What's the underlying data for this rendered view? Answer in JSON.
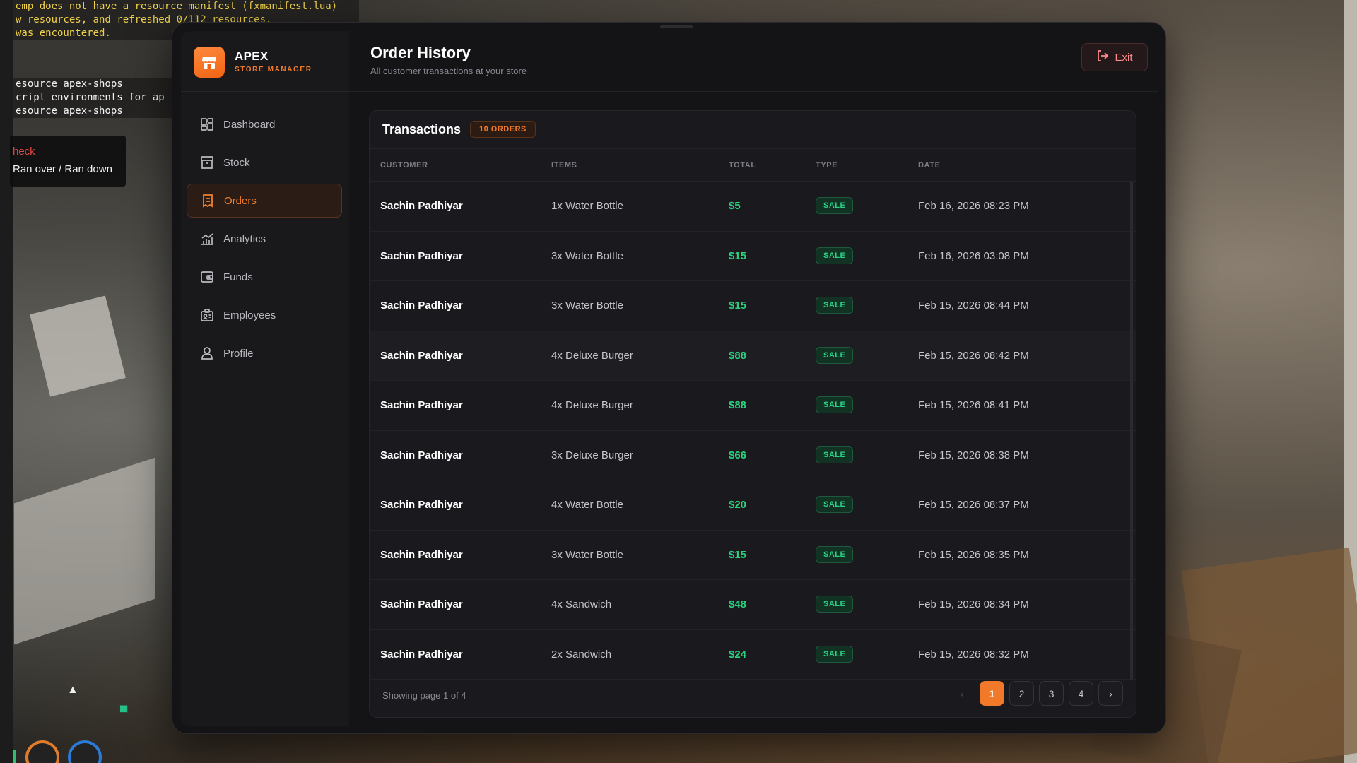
{
  "console": {
    "lines": [
      "emp does not have a resource manifest (fxmanifest.lua)",
      "w resources, and refreshed 0/112 resources.",
      " was encountered."
    ],
    "lines2": [
      "esource apex-shops",
      "cript environments for ap",
      "esource apex-shops"
    ]
  },
  "notice": {
    "title": "heck",
    "text": "Ran over / Ran down"
  },
  "brand": {
    "name": "APEX",
    "subtitle": "STORE MANAGER"
  },
  "sidebar": {
    "items": [
      {
        "label": "Dashboard",
        "icon": "dashboard-icon"
      },
      {
        "label": "Stock",
        "icon": "box-icon"
      },
      {
        "label": "Orders",
        "icon": "receipt-icon",
        "active": true
      },
      {
        "label": "Analytics",
        "icon": "chart-icon"
      },
      {
        "label": "Funds",
        "icon": "wallet-icon"
      },
      {
        "label": "Employees",
        "icon": "id-card-icon"
      },
      {
        "label": "Profile",
        "icon": "user-icon"
      }
    ]
  },
  "header": {
    "title": "Order History",
    "subtitle": "All customer transactions at your store",
    "exit_label": "Exit"
  },
  "transactions": {
    "title": "Transactions",
    "badge": "10 ORDERS",
    "columns": [
      "CUSTOMER",
      "ITEMS",
      "TOTAL",
      "TYPE",
      "DATE"
    ],
    "rows": [
      {
        "customer": "Sachin Padhiyar",
        "items": "1x Water Bottle",
        "total": "$5",
        "type": "SALE",
        "date": "Feb 16, 2026 08:23 PM"
      },
      {
        "customer": "Sachin Padhiyar",
        "items": "3x Water Bottle",
        "total": "$15",
        "type": "SALE",
        "date": "Feb 16, 2026 03:08 PM"
      },
      {
        "customer": "Sachin Padhiyar",
        "items": "3x Water Bottle",
        "total": "$15",
        "type": "SALE",
        "date": "Feb 15, 2026 08:44 PM"
      },
      {
        "customer": "Sachin Padhiyar",
        "items": "4x Deluxe Burger",
        "total": "$88",
        "type": "SALE",
        "date": "Feb 15, 2026 08:42 PM"
      },
      {
        "customer": "Sachin Padhiyar",
        "items": "4x Deluxe Burger",
        "total": "$88",
        "type": "SALE",
        "date": "Feb 15, 2026 08:41 PM"
      },
      {
        "customer": "Sachin Padhiyar",
        "items": "3x Deluxe Burger",
        "total": "$66",
        "type": "SALE",
        "date": "Feb 15, 2026 08:38 PM"
      },
      {
        "customer": "Sachin Padhiyar",
        "items": "4x Water Bottle",
        "total": "$20",
        "type": "SALE",
        "date": "Feb 15, 2026 08:37 PM"
      },
      {
        "customer": "Sachin Padhiyar",
        "items": "3x Water Bottle",
        "total": "$15",
        "type": "SALE",
        "date": "Feb 15, 2026 08:35 PM"
      },
      {
        "customer": "Sachin Padhiyar",
        "items": "4x Sandwich",
        "total": "$48",
        "type": "SALE",
        "date": "Feb 15, 2026 08:34 PM"
      },
      {
        "customer": "Sachin Padhiyar",
        "items": "2x Sandwich",
        "total": "$24",
        "type": "SALE",
        "date": "Feb 15, 2026 08:32 PM"
      }
    ],
    "pager_text": "Showing page 1 of 4",
    "pages": [
      "1",
      "2",
      "3",
      "4"
    ],
    "current_page": "1",
    "prev_icon": "‹",
    "next_icon": "›"
  },
  "colors": {
    "accent": "#f07a2a",
    "sale_green": "#2bd184",
    "exit_red": "#ff8b8b",
    "window_bg": "#141417"
  }
}
